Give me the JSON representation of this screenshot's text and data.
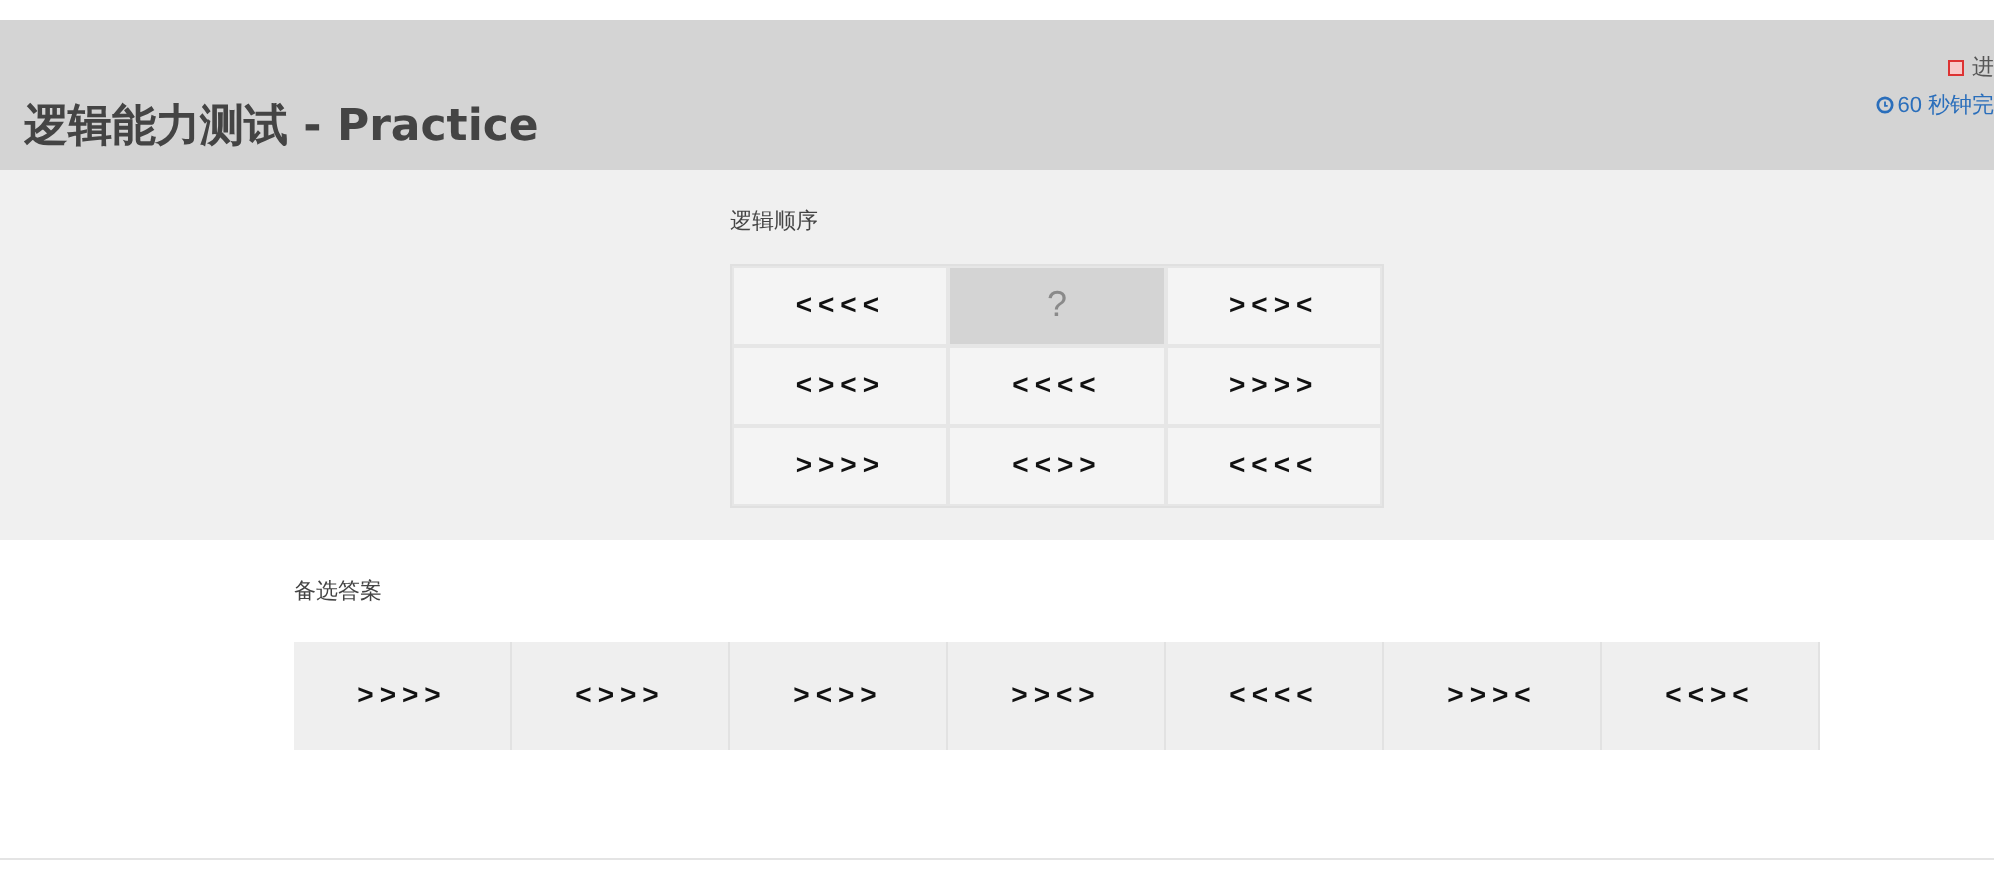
{
  "header": {
    "title": "逻辑能力测试 - Practice",
    "status": "进",
    "timer": "60 秒钟完"
  },
  "puzzle": {
    "label": "逻辑顺序",
    "cells": [
      {
        "text": "<<<<",
        "kind": "sequence"
      },
      {
        "text": "?",
        "kind": "missing"
      },
      {
        "text": "><><",
        "kind": "sequence"
      },
      {
        "text": "<><>",
        "kind": "sequence"
      },
      {
        "text": "<<<<",
        "kind": "sequence"
      },
      {
        "text": ">>>>",
        "kind": "sequence"
      },
      {
        "text": ">>>>",
        "kind": "sequence"
      },
      {
        "text": "<<>>",
        "kind": "sequence"
      },
      {
        "text": "<<<<",
        "kind": "sequence"
      }
    ]
  },
  "answers": {
    "label": "备选答案",
    "options": [
      ">>>>",
      "<>>>",
      "><>>",
      ">><>",
      "<<<<",
      ">>><",
      "<<><"
    ]
  }
}
